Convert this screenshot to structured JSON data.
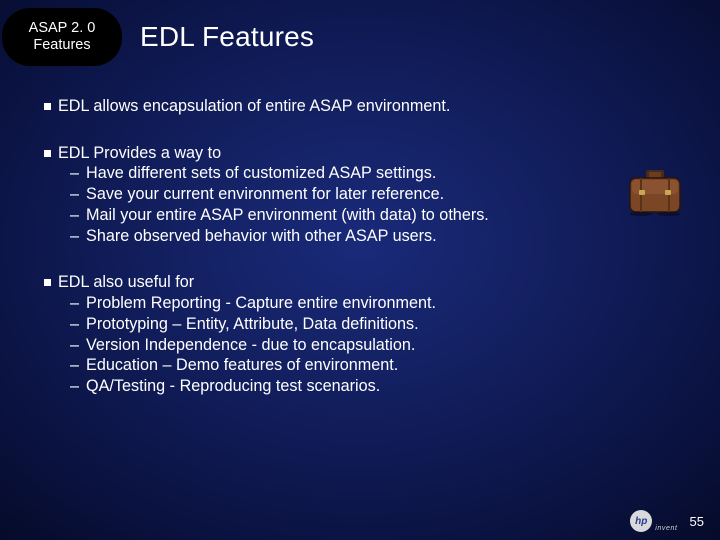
{
  "badge": {
    "line1": "ASAP 2. 0",
    "line2": "Features"
  },
  "title": "EDL Features",
  "bullets": [
    {
      "text": "EDL allows encapsulation of entire ASAP environment.",
      "children": []
    },
    {
      "text": "EDL Provides a way to",
      "children": [
        "Have different sets of customized ASAP settings.",
        "Save your current environment for later reference.",
        "Mail your entire ASAP environment (with data) to others.",
        "Share observed behavior with other ASAP users."
      ]
    },
    {
      "text": "EDL also useful for",
      "children": [
        "Problem Reporting - Capture entire environment.",
        "Prototyping – Entity, Attribute, Data definitions.",
        "Version Independence - due to encapsulation.",
        "Education – Demo features of environment.",
        "QA/Testing - Reproducing test scenarios."
      ]
    }
  ],
  "page_number": "55",
  "logo": {
    "initials": "hp",
    "word": "invent"
  },
  "icons": {
    "briefcase": "briefcase-icon"
  }
}
